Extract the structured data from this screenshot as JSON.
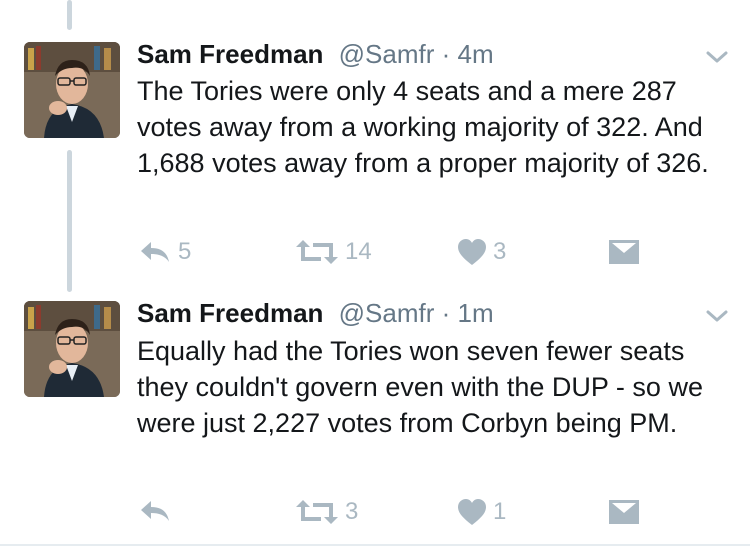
{
  "tweets": [
    {
      "name": "Sam Freedman",
      "handle": "@Samfr",
      "separator": "·",
      "time": "4m",
      "text": "The Tories were only 4 seats and a mere 287 votes away from a working majority of 322. And 1,688 votes away from a proper majority of 326.",
      "reply_count": "5",
      "retweet_count": "14",
      "like_count": "3"
    },
    {
      "name": "Sam Freedman",
      "handle": "@Samfr",
      "separator": "·",
      "time": "1m",
      "text": "Equally had the Tories won seven fewer seats they couldn't govern even with the DUP - so we were just 2,227 votes from Corbyn being PM.",
      "reply_count": "",
      "retweet_count": "3",
      "like_count": "1"
    }
  ],
  "icons": {
    "reply": "reply-icon",
    "retweet": "retweet-icon",
    "like": "heart-icon",
    "dm": "envelope-icon",
    "more": "chevron-down-icon"
  },
  "colors": {
    "text": "#14171a",
    "muted": "#657786",
    "action": "#aab8c2",
    "thread_line": "#ccd6dd"
  }
}
